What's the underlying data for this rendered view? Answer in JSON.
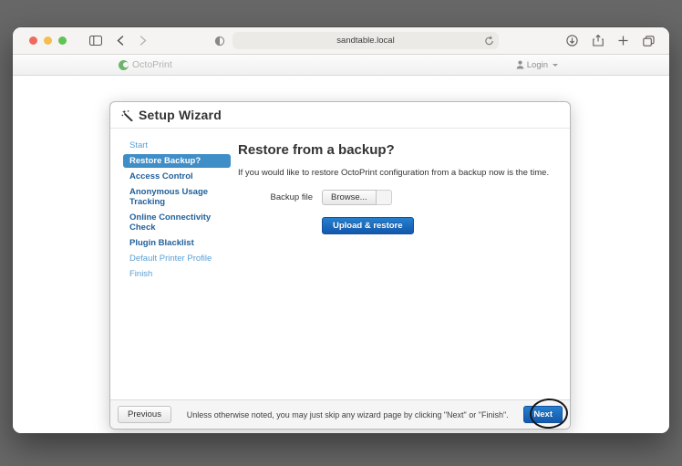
{
  "browser": {
    "url": "sandtable.local",
    "traffic_lights": {
      "close": "#ee6a5f",
      "minimize": "#f5bd4f",
      "zoom": "#61c354"
    }
  },
  "navbar": {
    "brand": "OctoPrint",
    "brand_green": "#6cb46c",
    "login_label": "Login"
  },
  "wizard": {
    "title": "Setup Wizard",
    "steps": [
      {
        "label": "Start",
        "state": "done"
      },
      {
        "label": "Restore Backup?",
        "state": "active"
      },
      {
        "label": "Access Control",
        "state": "required"
      },
      {
        "label": "Anonymous Usage Tracking",
        "state": "required"
      },
      {
        "label": "Online Connectivity Check",
        "state": "required"
      },
      {
        "label": "Plugin Blacklist",
        "state": "required"
      },
      {
        "label": "Default Printer Profile",
        "state": "optional"
      },
      {
        "label": "Finish",
        "state": "optional"
      }
    ],
    "content": {
      "heading": "Restore from a backup?",
      "description": "If you would like to restore OctoPrint configuration from a backup now is the time.",
      "file_label": "Backup file",
      "browse_button": "Browse...",
      "upload_button": "Upload & restore"
    },
    "footer": {
      "previous_button": "Previous",
      "note": "Unless otherwise noted, you may just skip any wizard page by clicking \"Next\" or \"Finish\".",
      "next_button": "Next"
    },
    "colors": {
      "active_step_bg": "#3f8ec8",
      "required_step_link": "#20609a",
      "optional_step_link": "#5a9fd4",
      "primary_button": "#1a64bd"
    }
  }
}
